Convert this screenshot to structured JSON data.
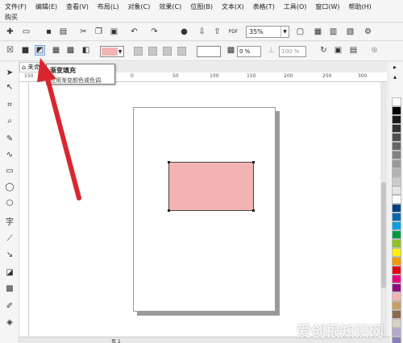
{
  "menu": {
    "items": [
      "文件(F)",
      "编辑(E)",
      "查看(V)",
      "布局(L)",
      "对象(C)",
      "效果(C)",
      "位图(B)",
      "文本(X)",
      "表格(T)",
      "工具(O)",
      "窗口(W)",
      "帮助(H)"
    ],
    "second_row": "购买"
  },
  "toolbar": {
    "zoom_value": "35%",
    "pdf_label": "PDF"
  },
  "property_bar": {
    "fill_color": "#f4b3b3",
    "outline_width": "0 %",
    "transparency": "100 %"
  },
  "document": {
    "tab_label": "未命"
  },
  "ruler": {
    "ticks": [
      "150",
      "100",
      "50",
      "0",
      "50",
      "100",
      "150",
      "200",
      "250",
      "300"
    ]
  },
  "tooltip": {
    "title": "渐变填充",
    "body": "应用渐变颜色或色调."
  },
  "palette": {
    "colors": [
      "#ffffff",
      "#000000",
      "#1a1a1a",
      "#333333",
      "#4d4d4d",
      "#666666",
      "#808080",
      "#999999",
      "#b3b3b3",
      "#cccccc",
      "#e6e6e6",
      "#ffffff",
      "#003f87",
      "#006ab3",
      "#00a0e0",
      "#009944",
      "#8fc31f",
      "#fff100",
      "#f39800",
      "#e60012",
      "#e4007f",
      "#920783",
      "#f4b3b3",
      "#c9a063",
      "#8b6a4b",
      "#d9d2c2",
      "#b5a6d1",
      "#8a7fb8"
    ]
  },
  "status": {
    "page_label": "页 1"
  },
  "watermark": "爱创根知识网",
  "colors": {
    "arrow": "#d9262e",
    "rect_fill": "#f4b3b3"
  }
}
